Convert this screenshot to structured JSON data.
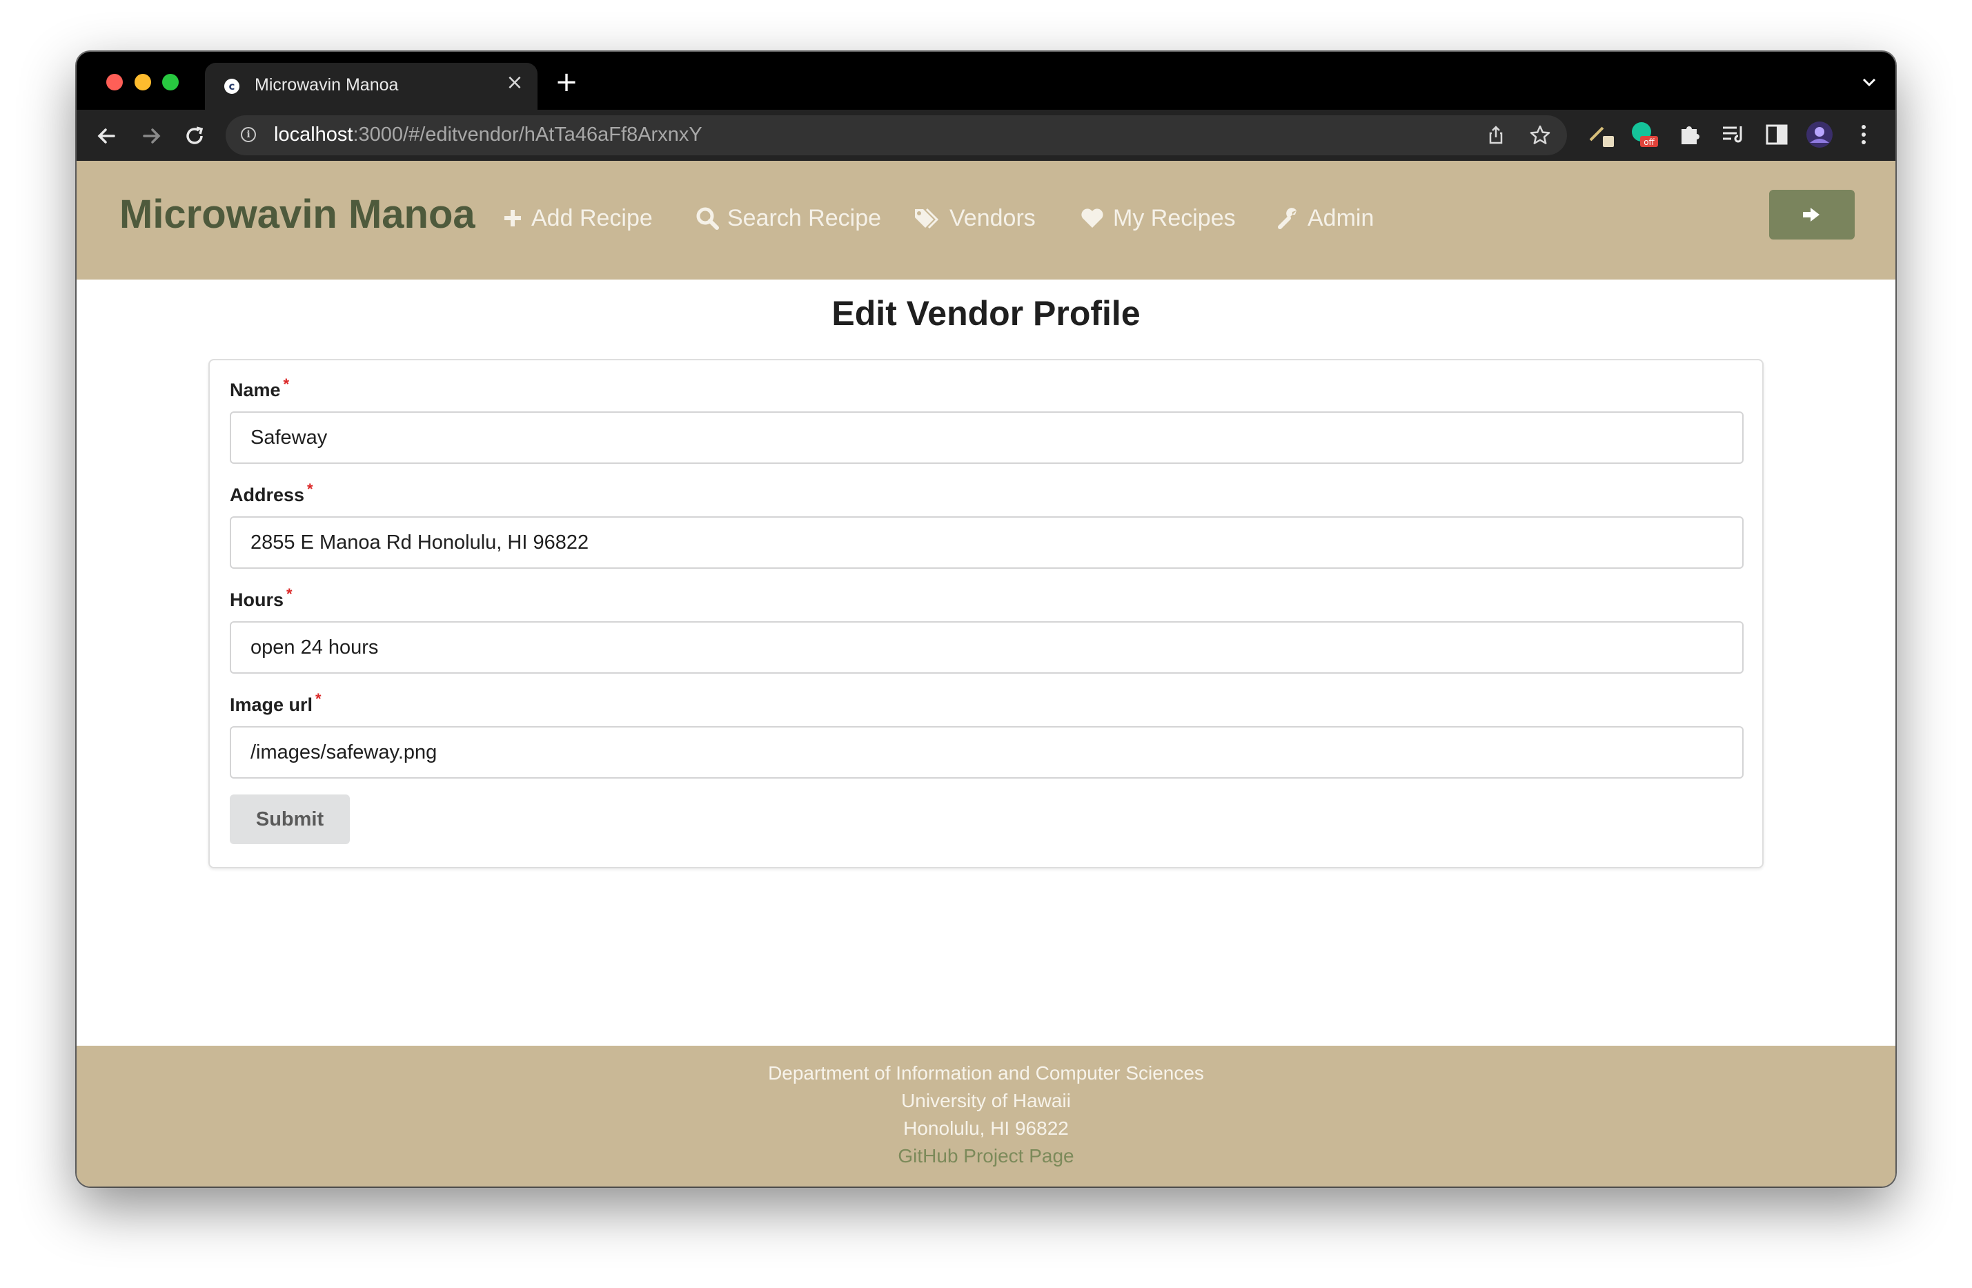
{
  "browser": {
    "tab_title": "Microwavin Manoa",
    "url_host": "localhost",
    "url_path": ":3000/#/editvendor/hAtTa46aFf8ArxnxY",
    "extension_badge": "off"
  },
  "navbar": {
    "brand": "Microwavin Manoa",
    "items": [
      {
        "label": "Add Recipe",
        "icon": "plus-icon"
      },
      {
        "label": "Search Recipe",
        "icon": "search-icon"
      },
      {
        "label": "Vendors",
        "icon": "tags-icon"
      },
      {
        "label": "My Recipes",
        "icon": "heart-icon"
      },
      {
        "label": "Admin",
        "icon": "wrench-icon"
      }
    ],
    "logout_icon": "sign-out-icon"
  },
  "page": {
    "title": "Edit Vendor Profile"
  },
  "form": {
    "required_marker": "*",
    "fields": [
      {
        "label": "Name",
        "value": "Safeway"
      },
      {
        "label": "Address",
        "value": "2855 E Manoa Rd Honolulu, HI 96822"
      },
      {
        "label": "Hours",
        "value": "open 24 hours"
      },
      {
        "label": "Image url",
        "value": "/images/safeway.png"
      }
    ],
    "submit_label": "Submit"
  },
  "footer": {
    "lines": [
      "Department of Information and Computer Sciences",
      "University of Hawaii",
      "Honolulu, HI 96822"
    ],
    "link_text": "GitHub Project Page"
  },
  "colors": {
    "navbar_bg": "#c9b896",
    "brand_text": "#4e5a3c",
    "logout_bg": "#7a845d",
    "required": "#db2828",
    "footer_link": "#7c8a5a"
  }
}
